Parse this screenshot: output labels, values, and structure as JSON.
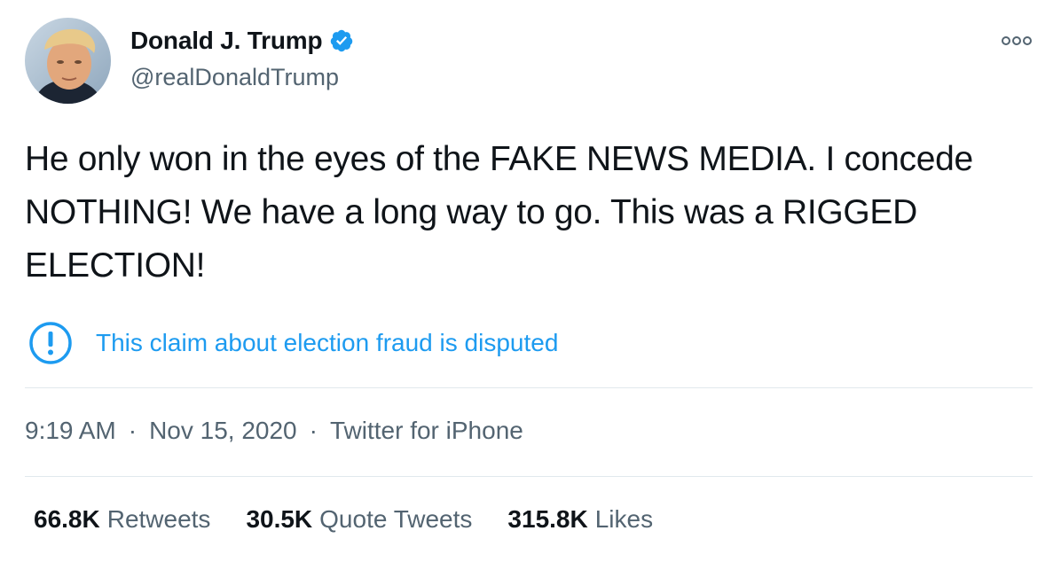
{
  "author": {
    "display_name": "Donald J. Trump",
    "handle": "@realDonaldTrump",
    "verified": true,
    "avatar_icon": "profile-photo"
  },
  "tweet": {
    "text": "He only won in the eyes of the FAKE NEWS MEDIA. I concede NOTHING! We have a long way to go. This was a RIGGED ELECTION!"
  },
  "notice": {
    "icon": "exclamation-circle-icon",
    "text": "This claim about election fraud is disputed"
  },
  "meta": {
    "time": "9:19 AM",
    "separator": "·",
    "date": "Nov 15, 2020",
    "source": "Twitter for iPhone"
  },
  "stats": {
    "retweets_count": "66.8K",
    "retweets_label": "Retweets",
    "quote_count": "30.5K",
    "quote_label": "Quote Tweets",
    "likes_count": "315.8K",
    "likes_label": "Likes"
  },
  "colors": {
    "accent": "#1d9bf0",
    "text": "#0f1419",
    "secondary": "#536471",
    "divider": "#e1e8ed"
  }
}
